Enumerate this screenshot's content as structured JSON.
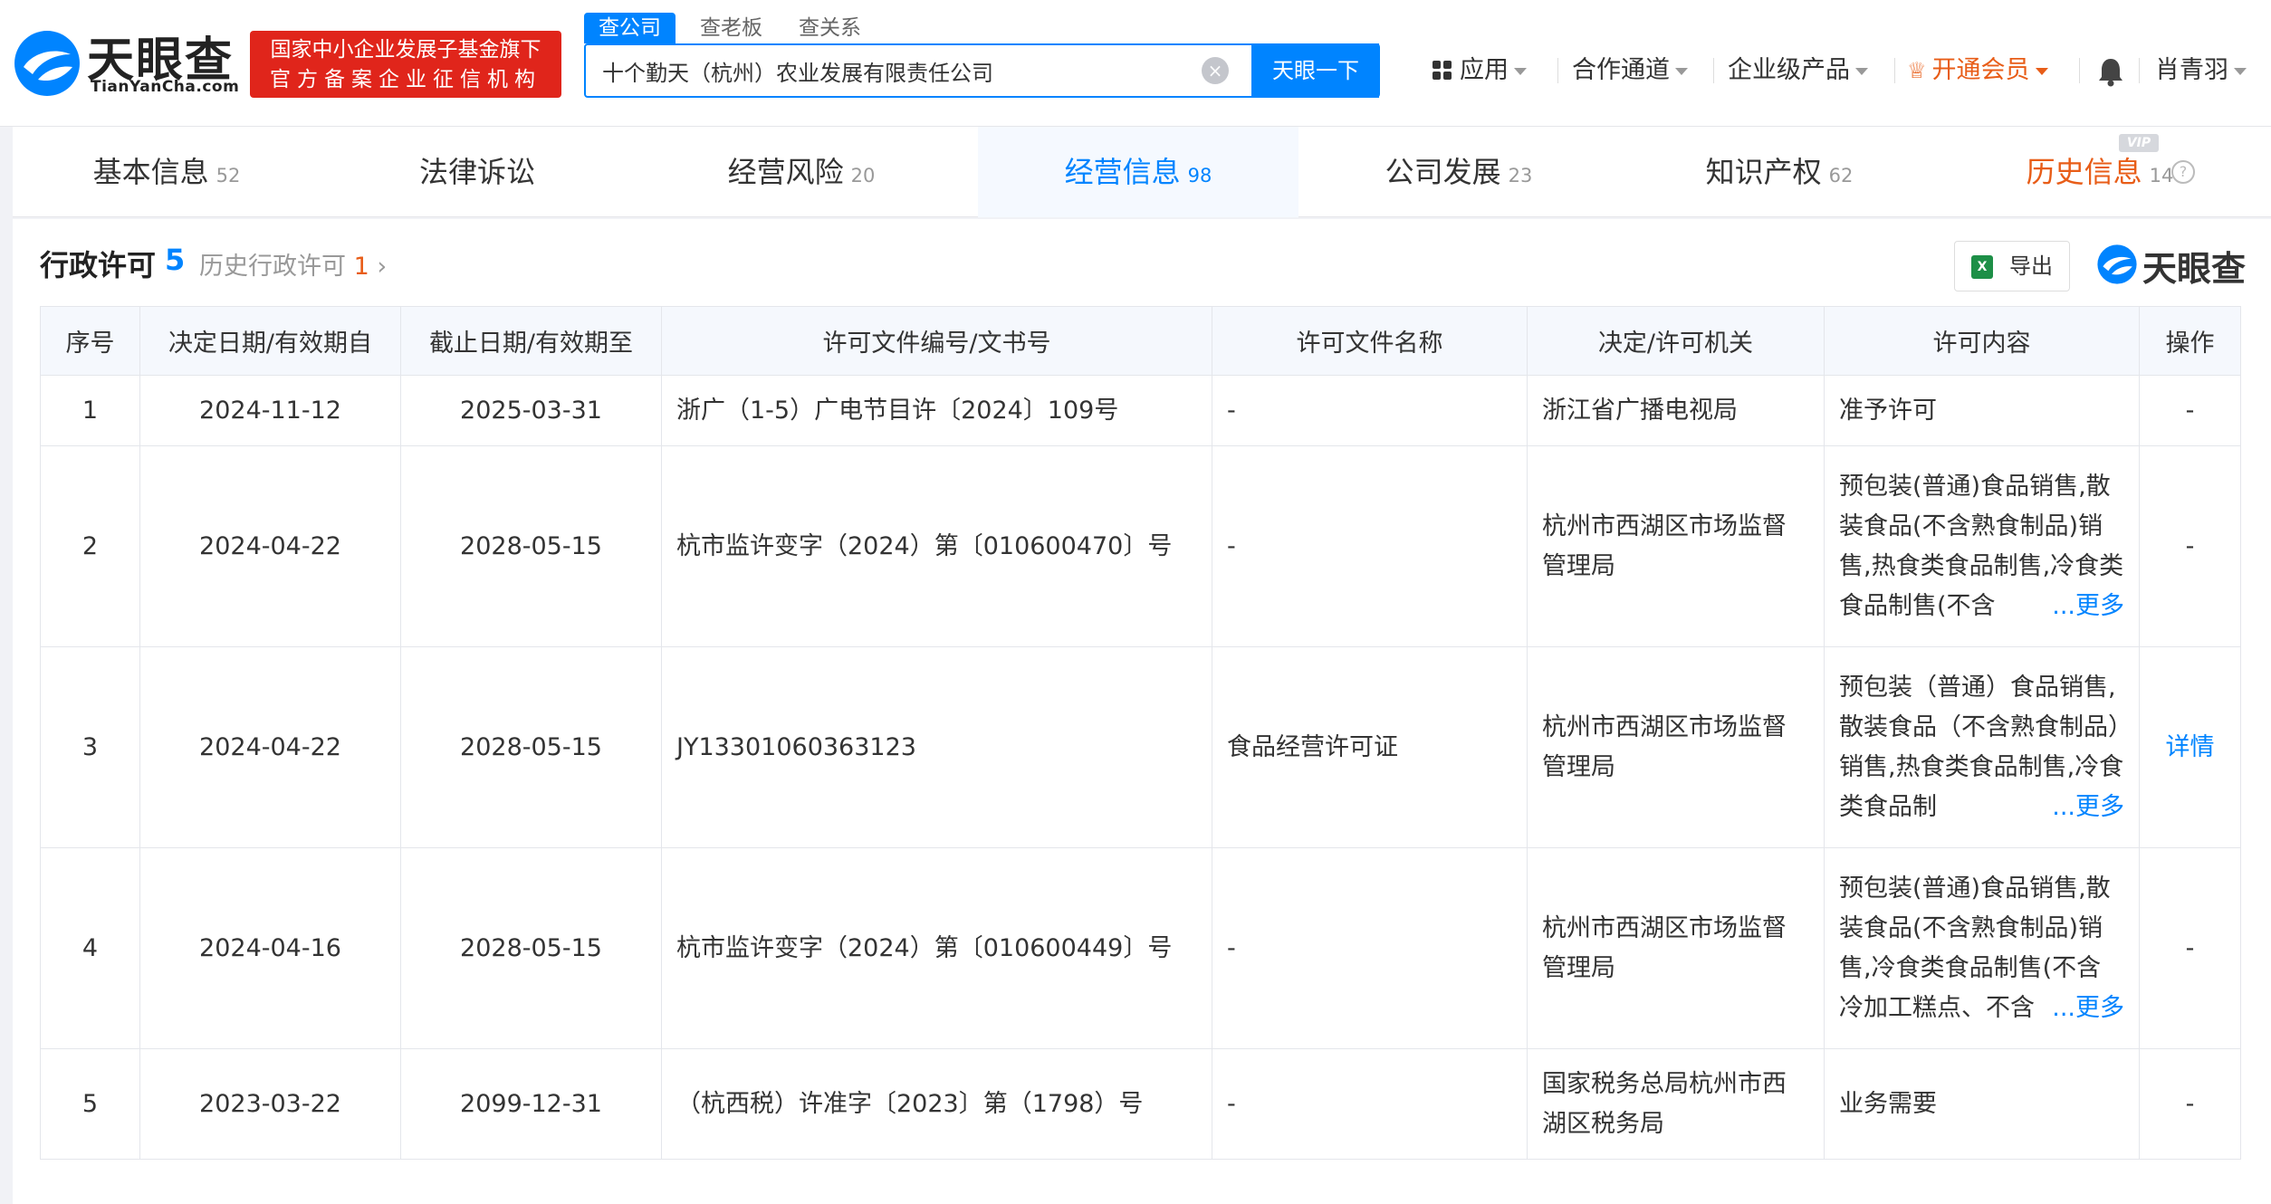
{
  "header": {
    "logo_text": "天眼查",
    "logo_sub": "TianYanCha.com",
    "gov_badge_line1": "国家中小企业发展子基金旗下",
    "gov_badge_line2": "官方备案企业征信机构",
    "search_tabs": [
      "查公司",
      "查老板",
      "查关系"
    ],
    "search_value": "十个勤天（杭州）农业发展有限责任公司",
    "search_button": "天眼一下",
    "nav": {
      "apps": "应用",
      "cooperation": "合作通道",
      "enterprise": "企业级产品",
      "vip": "开通会员",
      "user": "肖青羽"
    }
  },
  "tabs": [
    {
      "label": "基本信息",
      "count": "52"
    },
    {
      "label": "法律诉讼",
      "count": ""
    },
    {
      "label": "经营风险",
      "count": "20"
    },
    {
      "label": "经营信息",
      "count": "98"
    },
    {
      "label": "公司发展",
      "count": "23"
    },
    {
      "label": "知识产权",
      "count": "62"
    },
    {
      "label": "历史信息",
      "count": "14"
    }
  ],
  "vip_badge": "VIP",
  "section": {
    "title": "行政许可",
    "count": "5",
    "history_label": "历史行政许可",
    "history_count": "1",
    "export_label": "导出",
    "watermark": "天眼查"
  },
  "table": {
    "headers": [
      "序号",
      "决定日期/有效期自",
      "截止日期/有效期至",
      "许可文件编号/文书号",
      "许可文件名称",
      "决定/许可机关",
      "许可内容",
      "操作"
    ],
    "more_label": "...更多",
    "rows": [
      {
        "no": "1",
        "from": "2024-11-12",
        "to": "2025-03-31",
        "doc_no": "浙广（1-5）广电节目许〔2024〕109号",
        "doc_name": "-",
        "authority": "浙江省广播电视局",
        "content": "准予许可",
        "action": "-"
      },
      {
        "no": "2",
        "from": "2024-04-22",
        "to": "2028-05-15",
        "doc_no": "杭市监许变字（2024）第〔010600470〕号",
        "doc_name": "-",
        "authority": "杭州市西湖区市场监督管理局",
        "content": "预包装(普通)食品销售,散装食品(不含熟食制品)销售,热食类食品制售,冷食类食品制售(不含",
        "action": "-"
      },
      {
        "no": "3",
        "from": "2024-04-22",
        "to": "2028-05-15",
        "doc_no": "JY13301060363123",
        "doc_name": "食品经营许可证",
        "authority": "杭州市西湖区市场监督管理局",
        "content": "预包装（普通）食品销售,散装食品（不含熟食制品）销售,热食类食品制售,冷食类食品制",
        "action": "详情"
      },
      {
        "no": "4",
        "from": "2024-04-16",
        "to": "2028-05-15",
        "doc_no": "杭市监许变字（2024）第〔010600449〕号",
        "doc_name": "-",
        "authority": "杭州市西湖区市场监督管理局",
        "content": "预包装(普通)食品销售,散装食品(不含熟食制品)销售,冷食类食品制售(不含冷加工糕点、不含",
        "action": "-"
      },
      {
        "no": "5",
        "from": "2023-03-22",
        "to": "2099-12-31",
        "doc_no": "（杭西税）许准字〔2023〕第（1798）号",
        "doc_name": "-",
        "authority": "国家税务总局杭州市西湖区税务局",
        "content": "业务需要",
        "action": "-"
      }
    ]
  }
}
